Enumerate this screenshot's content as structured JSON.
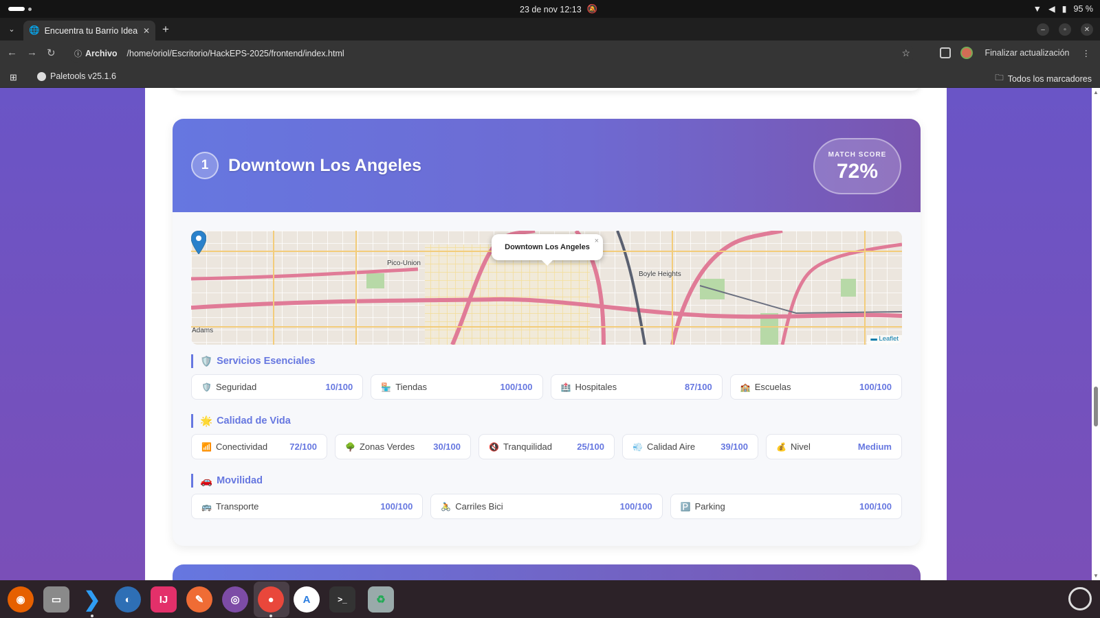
{
  "system_bar": {
    "clock": "23 de nov  12:13",
    "battery": "95 %"
  },
  "browser": {
    "tab_title": "Encuentra tu Barrio Ideal",
    "address_scheme": "Archivo",
    "address_url": "/home/oriol/Escritorio/HackEPS-2025/frontend/index.html",
    "update_button": "Finalizar actualización",
    "bookmark_item": "Paletools v25.1.6",
    "all_bookmarks": "Todos los marcadores"
  },
  "result": {
    "rank": "1",
    "name": "Downtown Los Angeles",
    "score_label": "MATCH SCORE",
    "score_value": "72%",
    "score_fraction": 0.72
  },
  "map": {
    "popup_title": "Downtown Los Angeles",
    "popup_close": "×",
    "labels": [
      "Pico-Union",
      "Boyle Heights",
      "Adams"
    ],
    "attribution": "Leaflet"
  },
  "sections": {
    "esenciales": {
      "title": "Servicios Esenciales",
      "icon": "🛡️",
      "items": [
        {
          "icon": "🛡️",
          "label": "Seguridad",
          "value": "10/100"
        },
        {
          "icon": "🏪",
          "label": "Tiendas",
          "value": "100/100"
        },
        {
          "icon": "🏥",
          "label": "Hospitales",
          "value": "87/100"
        },
        {
          "icon": "🏫",
          "label": "Escuelas",
          "value": "100/100"
        }
      ]
    },
    "calidad": {
      "title": "Calidad de Vida",
      "icon": "🌟",
      "items": [
        {
          "icon": "📶",
          "label": "Conectividad",
          "value": "72/100"
        },
        {
          "icon": "🌳",
          "label": "Zonas Verdes",
          "value": "30/100"
        },
        {
          "icon": "🔇",
          "label": "Tranquilidad",
          "value": "25/100"
        },
        {
          "icon": "💨",
          "label": "Calidad Aire",
          "value": "39/100"
        },
        {
          "icon": "💰",
          "label": "Nivel",
          "value": "Medium"
        }
      ]
    },
    "movilidad": {
      "title": "Movilidad",
      "icon": "🚗",
      "items": [
        {
          "icon": "🚌",
          "label": "Transporte",
          "value": "100/100"
        },
        {
          "icon": "🚴",
          "label": "Carriles Bici",
          "value": "100/100"
        },
        {
          "icon": "🅿️",
          "label": "Parking",
          "value": "100/100"
        }
      ]
    }
  },
  "colors": {
    "accent": "#6677e0",
    "header_start": "#6677e0",
    "header_end": "#7a55b0",
    "page_bg": "#6d55b8"
  }
}
